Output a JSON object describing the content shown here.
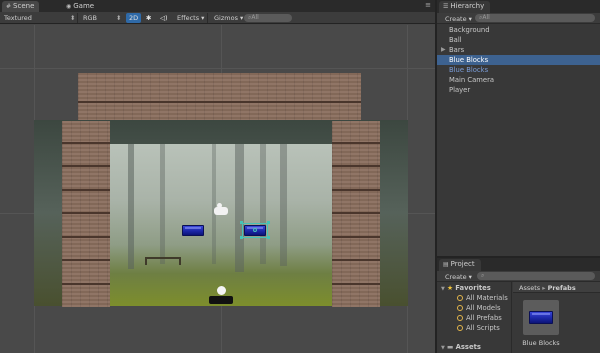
{
  "scene_tabs": {
    "scene": "Scene",
    "game": "Game"
  },
  "scene_toolbar": {
    "shading_mode": "Textured",
    "render_mode": "RGB",
    "mode_2d": "2D",
    "effects": "Effects",
    "gizmos": "Gizmos",
    "search_placeholder": "All"
  },
  "hierarchy": {
    "tab": "Hierarchy",
    "create": "Create",
    "search_placeholder": "All",
    "items": [
      {
        "label": "Background",
        "selected": false,
        "expandable": false,
        "prefab": false
      },
      {
        "label": "Ball",
        "selected": false,
        "expandable": false,
        "prefab": false
      },
      {
        "label": "Bars",
        "selected": false,
        "expandable": true,
        "prefab": false
      },
      {
        "label": "Blue Blocks",
        "selected": true,
        "expandable": false,
        "prefab": true
      },
      {
        "label": "Blue Blocks",
        "selected": false,
        "expandable": false,
        "prefab": true
      },
      {
        "label": "Main Camera",
        "selected": false,
        "expandable": false,
        "prefab": false
      },
      {
        "label": "Player",
        "selected": false,
        "expandable": false,
        "prefab": false
      }
    ]
  },
  "project": {
    "tab": "Project",
    "create": "Create",
    "favorites": {
      "label": "Favorites",
      "items": [
        "All Materials",
        "All Models",
        "All Prefabs",
        "All Scripts"
      ]
    },
    "assets_label": "Assets",
    "breadcrumb": [
      "Assets",
      "Prefabs"
    ],
    "asset": "Blue Blocks"
  },
  "colors": {
    "selection": "#3d6290",
    "prefab_text": "#7b9dd8",
    "block_blue": "#1c27a8"
  }
}
